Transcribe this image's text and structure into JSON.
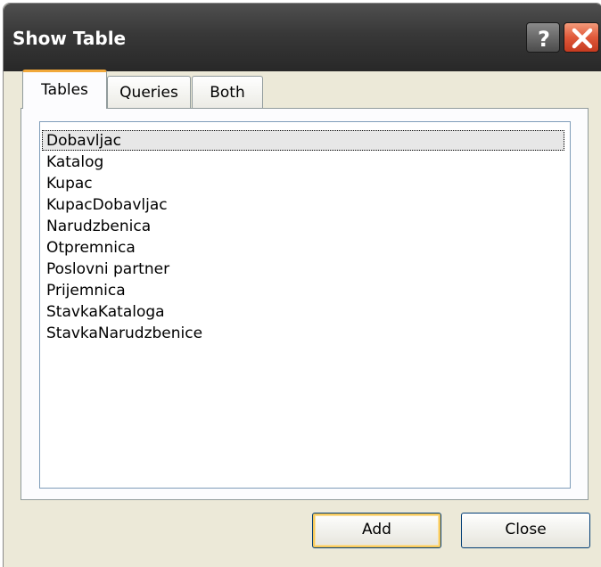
{
  "window": {
    "title": "Show Table",
    "help_icon": "help-icon",
    "close_icon": "close-icon",
    "close_color": "#e0593a"
  },
  "tabs": [
    {
      "label": "Tables",
      "active": true
    },
    {
      "label": "Queries",
      "active": false
    },
    {
      "label": "Both",
      "active": false
    }
  ],
  "accent_color": "#f1a83a",
  "list": {
    "selected_index": 0,
    "items": [
      "Dobavljac",
      "Katalog",
      "Kupac",
      "KupacDobavljac",
      "Narudzbenica",
      "Otpremnica",
      "Poslovni partner",
      "Prijemnica",
      "StavkaKataloga",
      "StavkaNarudzbenice"
    ]
  },
  "buttons": {
    "add_label": "Add",
    "close_label": "Close"
  }
}
